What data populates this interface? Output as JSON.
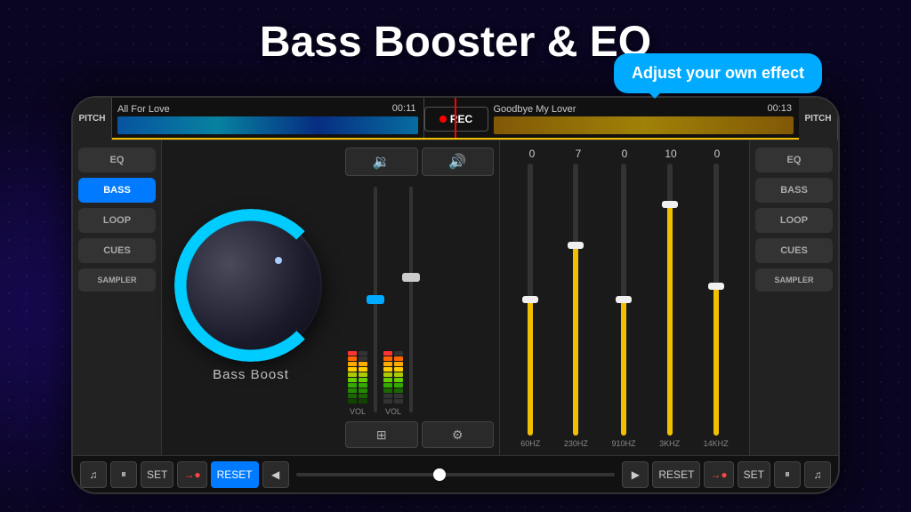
{
  "title": "Bass Booster & EQ",
  "tooltip": "Adjust your own effect",
  "waveform": {
    "track_left": "All For Love",
    "track_left_time": "00:11",
    "track_right": "Goodbye My Lover",
    "track_right_time": "00:13",
    "rec_label": "REC",
    "pitch_label": "PITCH"
  },
  "left_panel": {
    "buttons": [
      {
        "label": "EQ",
        "active": false
      },
      {
        "label": "BASS",
        "active": true
      },
      {
        "label": "LOOP",
        "active": false
      },
      {
        "label": "CUES",
        "active": false
      },
      {
        "label": "SAMPLER",
        "active": false
      }
    ]
  },
  "right_panel": {
    "buttons": [
      {
        "label": "EQ",
        "active": false
      },
      {
        "label": "BASS",
        "active": false
      },
      {
        "label": "LOOP",
        "active": false
      },
      {
        "label": "CUES",
        "active": false
      },
      {
        "label": "SAMPLER",
        "active": false
      }
    ]
  },
  "knob": {
    "label": "Bass  Boost"
  },
  "eq": {
    "values": [
      "0",
      "7",
      "0",
      "10",
      "0"
    ],
    "labels": [
      "60HZ",
      "230HZ",
      "910HZ",
      "3KHZ",
      "14KHZ"
    ],
    "positions": [
      0.5,
      0.3,
      0.5,
      0.15,
      0.45
    ]
  },
  "transport": {
    "set_label": "SET",
    "reset_label": "RESET",
    "set_label2": "SET"
  }
}
